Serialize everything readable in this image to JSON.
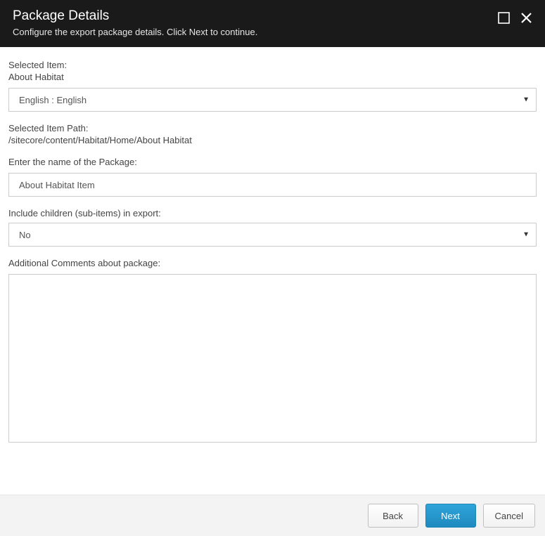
{
  "header": {
    "title": "Package Details",
    "subtitle": "Configure the export package details. Click Next to continue."
  },
  "selectedItem": {
    "label": "Selected Item:",
    "value": "About Habitat"
  },
  "language": {
    "selected": "English : English"
  },
  "selectedItemPath": {
    "label": "Selected Item Path:",
    "value": "/sitecore/content/Habitat/Home/About Habitat"
  },
  "packageName": {
    "label": "Enter the name of the Package:",
    "value": "About Habitat Item"
  },
  "includeChildren": {
    "label": "Include children (sub-items) in export:",
    "selected": "No"
  },
  "comments": {
    "label": "Additional Comments about package:",
    "value": ""
  },
  "footer": {
    "back": "Back",
    "next": "Next",
    "cancel": "Cancel"
  }
}
